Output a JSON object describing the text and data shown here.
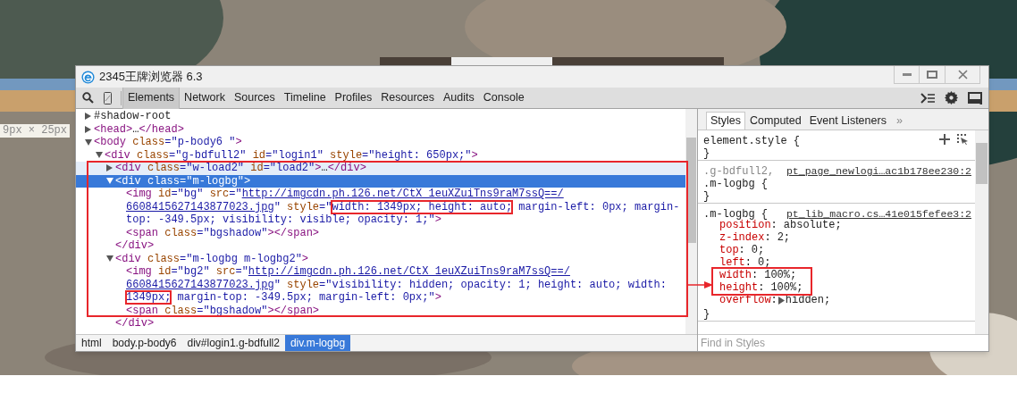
{
  "size_tooltip": "9px × 25px",
  "window": {
    "title": "2345王牌浏览器 6.3"
  },
  "toolbar": {
    "tabs": [
      {
        "label": "Elements",
        "selected": true
      },
      {
        "label": "Network",
        "selected": false
      },
      {
        "label": "Sources",
        "selected": false
      },
      {
        "label": "Timeline",
        "selected": false
      },
      {
        "label": "Profiles",
        "selected": false
      },
      {
        "label": "Resources",
        "selected": false
      },
      {
        "label": "Audits",
        "selected": false
      },
      {
        "label": "Console",
        "selected": false
      }
    ]
  },
  "dom": [
    {
      "expanded": false,
      "selected": false,
      "hovered": false,
      "lines": [
        [
          {
            "kind": "text",
            "text": "#shadow-root"
          }
        ]
      ]
    },
    {
      "expanded": false,
      "selected": false,
      "hovered": false,
      "lines": [
        [
          {
            "kind": "tag",
            "text": "<head>"
          },
          {
            "kind": "text",
            "text": "…"
          },
          {
            "kind": "tag",
            "text": "</head>"
          }
        ]
      ]
    },
    {
      "expanded": true,
      "selected": false,
      "hovered": false,
      "lines": [
        [
          {
            "kind": "tag",
            "text": "<body"
          },
          {
            "kind": "attr",
            "text": " class"
          },
          {
            "kind": "value",
            "text": "=\"p-body6 \""
          },
          {
            "kind": "tag",
            "text": ">"
          }
        ]
      ],
      "children": [
        {
          "expanded": true,
          "selected": false,
          "hovered": false,
          "lines": [
            [
              {
                "kind": "tag",
                "text": "<div"
              },
              {
                "kind": "attr",
                "text": " class"
              },
              {
                "kind": "value",
                "text": "=\"g-bdfull2\""
              },
              {
                "kind": "attr",
                "text": " id"
              },
              {
                "kind": "value",
                "text": "=\"login1\""
              },
              {
                "kind": "attr",
                "text": " style"
              },
              {
                "kind": "value",
                "text": "=\"height: 650px;\""
              },
              {
                "kind": "tag",
                "text": ">"
              }
            ]
          ],
          "children": [
            {
              "expanded": false,
              "selected": false,
              "hovered": true,
              "lines": [
                [
                  {
                    "kind": "tag",
                    "text": "<div"
                  },
                  {
                    "kind": "attr",
                    "text": " class"
                  },
                  {
                    "kind": "value",
                    "text": "=\"w-load2\""
                  },
                  {
                    "kind": "attr",
                    "text": " id"
                  },
                  {
                    "kind": "value",
                    "text": "=\"load2\""
                  },
                  {
                    "kind": "tag",
                    "text": ">"
                  },
                  {
                    "kind": "text",
                    "text": "…"
                  },
                  {
                    "kind": "tag",
                    "text": "</div>"
                  }
                ]
              ]
            },
            {
              "expanded": true,
              "selected": true,
              "hovered": false,
              "closing": "</div>",
              "lines": [
                [
                  {
                    "kind": "tag",
                    "text": "<div"
                  },
                  {
                    "kind": "attr",
                    "text": " class"
                  },
                  {
                    "kind": "value",
                    "text": "=\"m-logbg\""
                  },
                  {
                    "kind": "tag",
                    "text": ">"
                  }
                ]
              ],
              "children": [
                {
                  "selected": false,
                  "hovered": false,
                  "lines": [
                    [
                      {
                        "kind": "tag",
                        "text": "<img"
                      },
                      {
                        "kind": "attr",
                        "text": " id"
                      },
                      {
                        "kind": "value",
                        "text": "=\"bg\""
                      },
                      {
                        "kind": "attr",
                        "text": " src"
                      },
                      {
                        "kind": "value",
                        "text": "=\""
                      },
                      {
                        "kind": "link",
                        "text": "http://imgcdn.ph.126.net/CtX_1euXZuiTns9raM7ssQ==/"
                      }
                    ],
                    [
                      {
                        "kind": "link",
                        "text": "6608415627143877023.jpg"
                      },
                      {
                        "kind": "value",
                        "text": "\""
                      },
                      {
                        "kind": "attr",
                        "text": " style"
                      },
                      {
                        "kind": "value",
                        "text": "=\""
                      },
                      {
                        "kind": "value",
                        "text": "width: 1349px; height: auto;",
                        "boxed": true
                      },
                      {
                        "kind": "value",
                        "text": " margin-left: 0px; margin-"
                      }
                    ],
                    [
                      {
                        "kind": "value",
                        "text": "top: -349.5px; visibility: visible; opacity: 1;\""
                      },
                      {
                        "kind": "tag",
                        "text": ">"
                      }
                    ]
                  ]
                },
                {
                  "selected": false,
                  "hovered": false,
                  "lines": [
                    [
                      {
                        "kind": "tag",
                        "text": "<span"
                      },
                      {
                        "kind": "attr",
                        "text": " class"
                      },
                      {
                        "kind": "value",
                        "text": "=\"bgshadow\""
                      },
                      {
                        "kind": "tag",
                        "text": "></span>"
                      }
                    ]
                  ]
                }
              ]
            },
            {
              "expanded": true,
              "selected": false,
              "hovered": false,
              "closing": "</div>",
              "lines": [
                [
                  {
                    "kind": "tag",
                    "text": "<div"
                  },
                  {
                    "kind": "attr",
                    "text": " class"
                  },
                  {
                    "kind": "value",
                    "text": "=\"m-logbg m-logbg2\""
                  },
                  {
                    "kind": "tag",
                    "text": ">"
                  }
                ]
              ],
              "children": [
                {
                  "selected": false,
                  "hovered": false,
                  "lines": [
                    [
                      {
                        "kind": "tag",
                        "text": "<img"
                      },
                      {
                        "kind": "attr",
                        "text": " id"
                      },
                      {
                        "kind": "value",
                        "text": "=\"bg2\""
                      },
                      {
                        "kind": "attr",
                        "text": " src"
                      },
                      {
                        "kind": "value",
                        "text": "=\""
                      },
                      {
                        "kind": "link",
                        "text": "http://imgcdn.ph.126.net/CtX_1euXZuiTns9raM7ssQ==/"
                      }
                    ],
                    [
                      {
                        "kind": "link",
                        "text": "6608415627143877023.jpg"
                      },
                      {
                        "kind": "value",
                        "text": "\""
                      },
                      {
                        "kind": "attr",
                        "text": " style"
                      },
                      {
                        "kind": "value",
                        "text": "=\"visibility: hidden; opacity: 1; height: auto; width:"
                      }
                    ],
                    [
                      {
                        "kind": "value",
                        "text": "1349px;",
                        "boxed": true
                      },
                      {
                        "kind": "value",
                        "text": " margin-top: -349.5px; margin-left: 0px;\""
                      },
                      {
                        "kind": "tag",
                        "text": ">"
                      }
                    ]
                  ]
                },
                {
                  "selected": false,
                  "hovered": false,
                  "lines": [
                    [
                      {
                        "kind": "tag",
                        "text": "<span"
                      },
                      {
                        "kind": "attr",
                        "text": " class"
                      },
                      {
                        "kind": "value",
                        "text": "=\"bgshadow\""
                      },
                      {
                        "kind": "tag",
                        "text": "></span>"
                      }
                    ]
                  ]
                }
              ]
            }
          ]
        }
      ]
    }
  ],
  "breadcrumbs": [
    {
      "label": "html",
      "selected": false
    },
    {
      "label": "body.p-body6",
      "selected": false
    },
    {
      "label": "div#login1.g-bdfull2",
      "selected": false
    },
    {
      "label": "div.m-logbg",
      "selected": true
    }
  ],
  "styles": {
    "tabs": [
      {
        "label": "Styles",
        "selected": true
      },
      {
        "label": "Computed",
        "selected": false
      },
      {
        "label": "Event Listeners",
        "selected": false
      }
    ],
    "more": "»",
    "rules": [
      {
        "kind": "inline",
        "selector_lines": [
          {
            "text": "element.style {",
            "dim": false
          }
        ],
        "close": "}"
      },
      {
        "kind": "matched",
        "selector_lines": [
          {
            "text": ".g-bdfull2,",
            "dim": true
          },
          {
            "text": ".m-logbg {",
            "dim": false
          }
        ],
        "source": "pt_page_newlogi…ac1b178ee230:2",
        "close": "}"
      },
      {
        "kind": "matched",
        "selector_lines": [
          {
            "text": ".m-logbg {",
            "dim": false
          }
        ],
        "source": "pt_lib_macro.cs…41e015fefee3:2",
        "properties": [
          {
            "name": "position",
            "colon": ":",
            "value": "absolute;",
            "boxed": false,
            "expandable": false
          },
          {
            "name": "z-index",
            "colon": ":",
            "value": "2;",
            "boxed": false,
            "expandable": false
          },
          {
            "name": "top",
            "colon": ":",
            "value": "0;",
            "boxed": false,
            "expandable": false
          },
          {
            "name": "left",
            "colon": ":",
            "value": "0;",
            "boxed": false,
            "expandable": false
          },
          {
            "name": "width",
            "colon": ":",
            "value": "100%;",
            "boxed": true,
            "expandable": false
          },
          {
            "name": "height",
            "colon": ":",
            "value": "100%;",
            "boxed": true,
            "expandable": false
          },
          {
            "name": "overflow",
            "colon": ":",
            "value": "hidden;",
            "boxed": false,
            "expandable": true
          }
        ],
        "close": "}"
      }
    ],
    "find_placeholder": "Find in Styles"
  }
}
